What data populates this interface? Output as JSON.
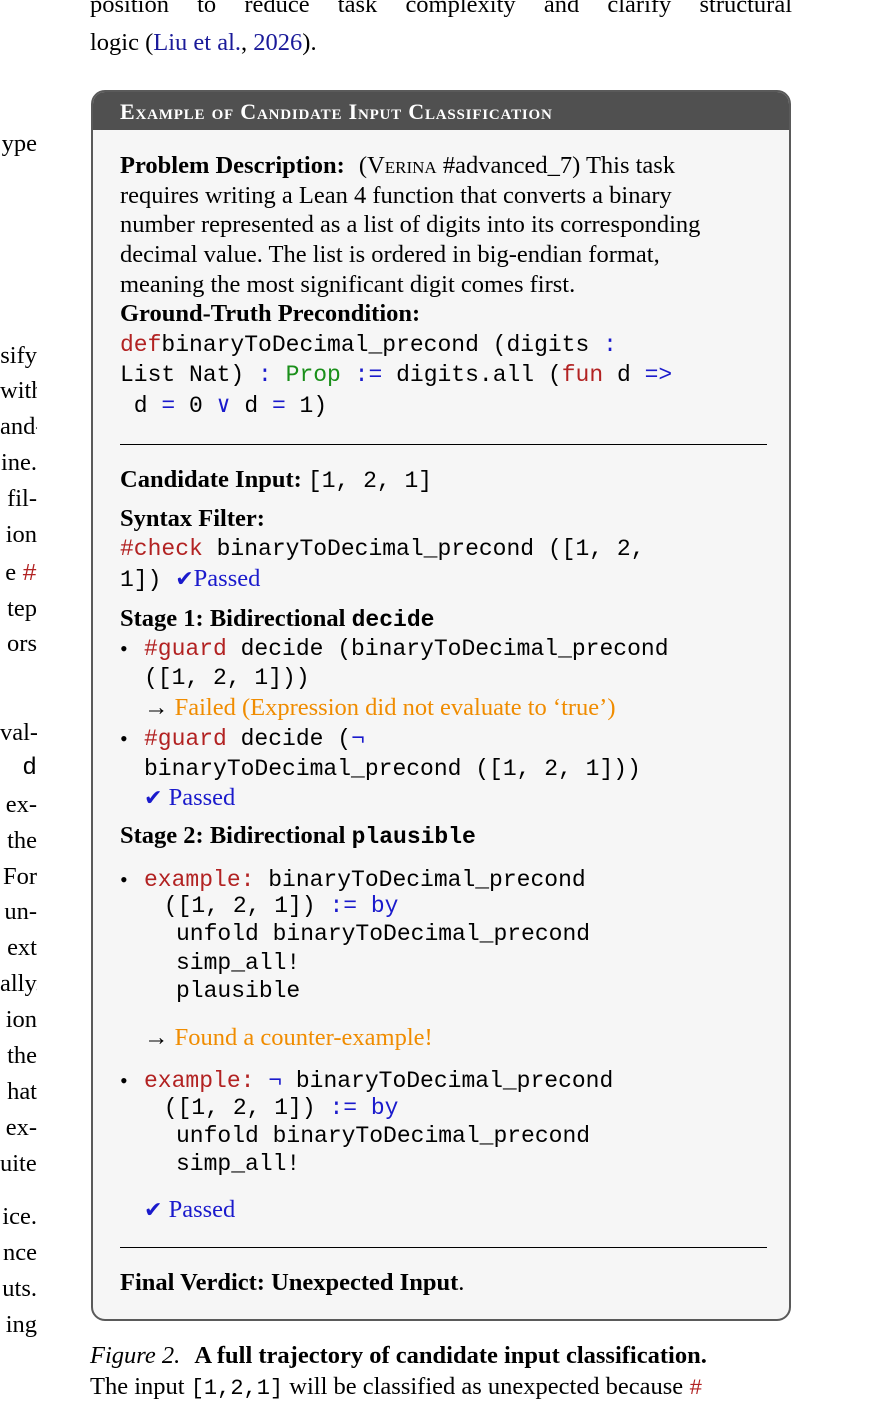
{
  "top_paragraph": {
    "line1": "position to reduce task complexity and clarify structural",
    "line2_prefix": "logic (",
    "citation_author": "Liu et al.",
    "citation_sep": ", ",
    "citation_year": "2026",
    "line2_suffix": ")."
  },
  "left_column_fragments": [
    "ype",
    "sify",
    "with",
    "and-",
    "ine.",
    "fil-",
    "ion",
    "e #",
    "tep",
    "ors",
    "val-",
    "d",
    "ex-",
    "the",
    "For",
    "un-",
    "ext",
    "ally.",
    "ion",
    "the",
    "hat",
    "ex-",
    "uite.",
    "ice.",
    "nce",
    "uts.",
    "ing"
  ],
  "box": {
    "title": "Example of Candidate Input Classification",
    "problem": {
      "label": "Problem Description:",
      "source_open": "(",
      "source_name": "Verina",
      "source_id": "#advanced_7)",
      "lines": [
        "This task",
        "requires writing a Lean 4 function that converts a binary",
        "number represented as a list of digits into its corresponding",
        "decimal value.  The list is ordered in big-endian format,",
        "meaning the most significant digit comes first."
      ]
    },
    "ground_truth": {
      "label": "Ground-Truth Precondition:",
      "code": [
        [
          [
            "red",
            "def"
          ],
          [
            "",
            "binaryToDecimal_precond (digits "
          ],
          [
            "blue",
            ":"
          ]
        ],
        [
          [
            "",
            "List Nat) "
          ],
          [
            "blue",
            ":"
          ],
          [
            "",
            ""
          ],
          [
            "green",
            " Prop"
          ],
          [
            "blue",
            " :="
          ],
          [
            "",
            ""
          ],
          [
            "",
            " digits.all ("
          ],
          [
            "red",
            "fun"
          ],
          [
            "",
            " d "
          ],
          [
            "blue",
            "=>"
          ]
        ],
        [
          [
            "",
            " d "
          ],
          [
            "blue",
            "="
          ],
          [
            "",
            " 0 "
          ],
          [
            "blue",
            "∨"
          ],
          [
            "",
            " d "
          ],
          [
            "blue",
            "="
          ],
          [
            "",
            " 1)"
          ]
        ]
      ]
    },
    "candidate": {
      "label": "Candidate Input:",
      "value": "[1, 2, 1]"
    },
    "syntax_filter": {
      "label": "Syntax Filter:",
      "line1_keyword": "#check",
      "line1_rest": " binaryToDecimal_precond ([1, 2,",
      "line2_code": "1])",
      "status": "Passed"
    },
    "stage1": {
      "label": "Stage 1: Bidirectional ",
      "label_code": "decide",
      "item1": {
        "keyword": "#guard",
        "line1_rest": " decide (binaryToDecimal_precond",
        "line2": "([1, 2, 1]))",
        "result": "Failed (Expression did not evaluate to ‘true’)"
      },
      "item2": {
        "keyword": "#guard",
        "line1_rest": " decide (",
        "neg": "¬",
        "line2": "binaryToDecimal_precond ([1, 2, 1]))",
        "status": "Passed"
      }
    },
    "stage2": {
      "label": "Stage 2: Bidirectional ",
      "label_code": "plausible",
      "item1": {
        "keyword": "example:",
        "line1_rest": " binaryToDecimal_precond",
        "line2_code": " ([1, 2, 1]) ",
        "line2_kw": ":= by",
        "line3": "unfold binaryToDecimal_precond",
        "line4": "simp_all!",
        "line5": "plausible",
        "result": "Found a counter-example!"
      },
      "item2": {
        "keyword": "example:",
        "neg": " ¬",
        "line1_rest": " binaryToDecimal_precond",
        "line2_code": " ([1, 2, 1]) ",
        "line2_kw": ":= by",
        "line3": "unfold binaryToDecimal_precond",
        "line4": "simp_all!",
        "status": "Passed"
      }
    },
    "verdict": {
      "label": "Final Verdict: Unexpected Input",
      "end": "."
    }
  },
  "caption": {
    "figure_label": "Figure 2.",
    "title": "A full trajectory of candidate input classification.",
    "line2_prefix": "The input ",
    "line2_code": "[1,2,1]",
    "line2_suffix": " will be classified as unexpected because ",
    "line2_hash": "#"
  },
  "colors": {
    "header_bg": "#505050",
    "box_bg": "#f6f6f6",
    "keyword_red": "#b22222",
    "operator_blue": "#1a1acc",
    "type_green": "#1a8f1a",
    "warning_orange": "#f08c00",
    "link_blue": "#1a1a99"
  },
  "icons": {
    "pass": "checkmark-icon",
    "arrow": "right-arrow-icon",
    "bullet": "bullet-dot"
  }
}
